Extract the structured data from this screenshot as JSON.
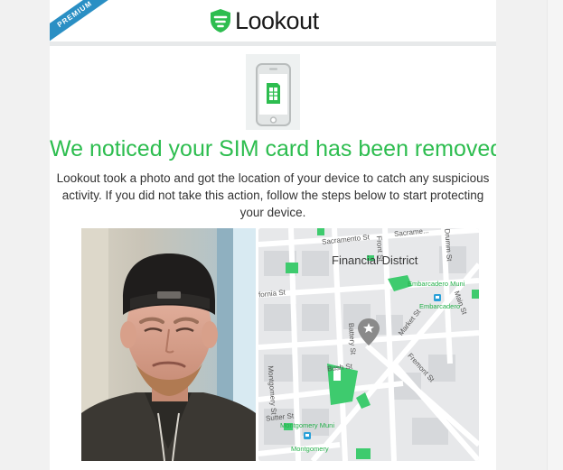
{
  "header": {
    "badge": "PREMIUM",
    "brand": "Lookout"
  },
  "alert": {
    "headline": "We noticed your SIM card has been removed.",
    "body": "Lookout took a photo and got the location of your device to catch any suspicious activity. If you did not take this action, follow the steps below to start protecting your device."
  },
  "map": {
    "district": "Financial District",
    "streets": {
      "sacramento": "Sacramento St",
      "sacramento2": "Sacrame...",
      "drumm": "Drumm St",
      "california": "fornia St",
      "battery": "Battery St",
      "market": "Market St",
      "bush": "Bush St",
      "fremont": "Fremont St",
      "montgomery": "Montgomery St",
      "sutter": "Sutter St",
      "main": "Main St",
      "front": "Front St"
    },
    "stations": {
      "embarcadero_muni": "Embarcadero Muni",
      "embarcadero": "Embarcadero",
      "montgomery_muni": "Montgomery Muni",
      "montgomery": "Montgomery"
    }
  },
  "colors": {
    "accent_green": "#2dbd4f",
    "badge_blue": "#2a8fc4",
    "map_park": "#3ecb6e"
  }
}
